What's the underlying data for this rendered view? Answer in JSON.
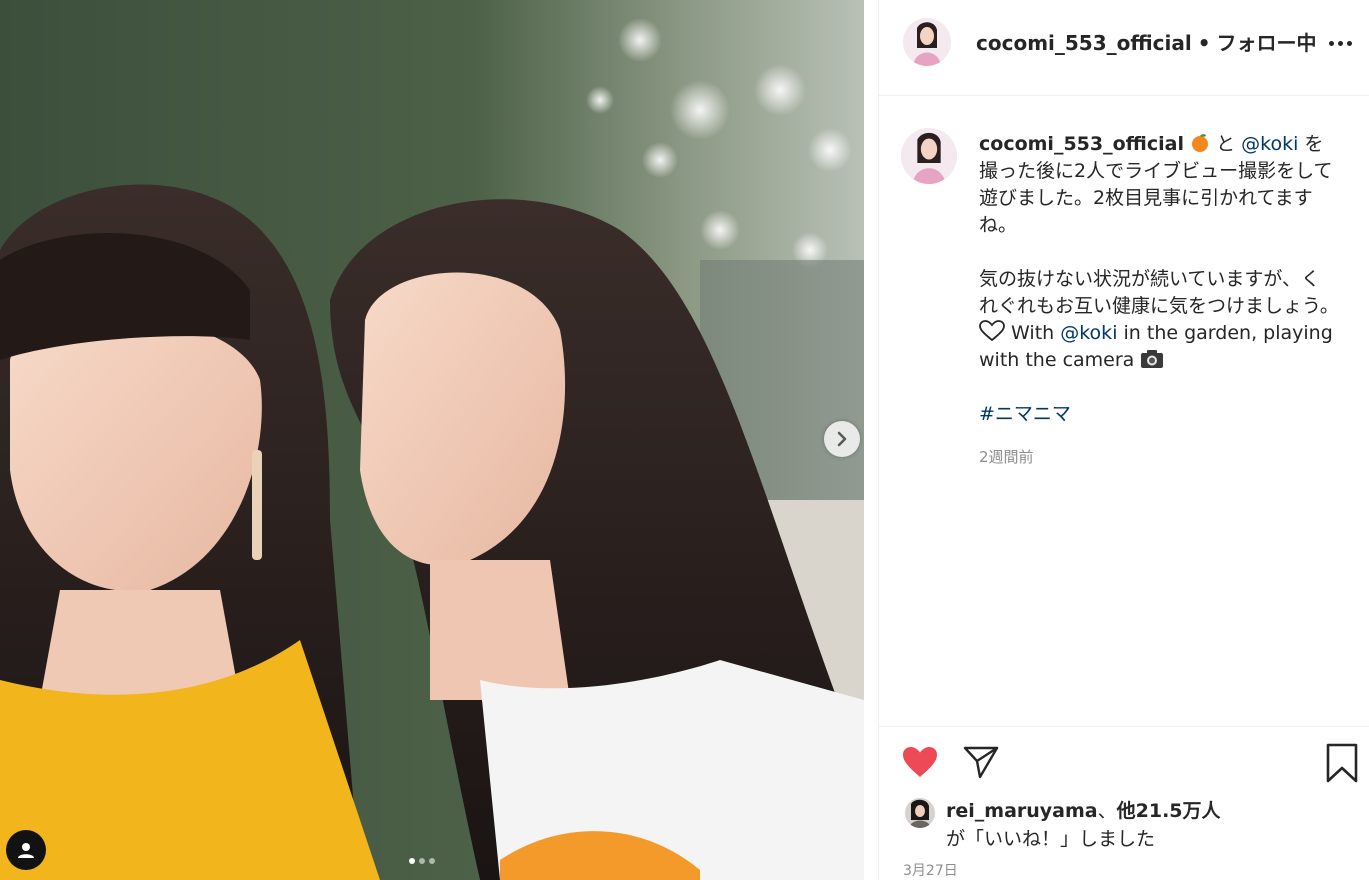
{
  "post": {
    "author": "cocomi_553_official",
    "separator": "•",
    "follow_state": "フォロー中",
    "carousel": {
      "total": 3,
      "current": 1
    }
  },
  "caption": {
    "author": "cocomi_553_official",
    "emoji_icon": "tangerine-icon",
    "part1": "と",
    "mention1": "@koki",
    "part2": "を撮った後に2人でライブビュー撮影をして遊びました。2枚目見事に引かれてますね。",
    "para2": "気の抜けない状況が続いていますが、くれぐれもお互い健康に気をつけましょう。",
    "heart_icon": "heart-outline-icon",
    "part3": "With",
    "mention2": "@koki",
    "part4": "in the garden, playing with the camera",
    "camera_icon": "camera-icon",
    "hashtag": "#ニマニマ",
    "time_ago": "2週間前"
  },
  "likes": {
    "liker": "rei_maruyama",
    "joiner": "、",
    "others": "他21.5万人",
    "suffix": "が「いいね！」しました",
    "liked": true
  },
  "date": "3月27日",
  "colors": {
    "like_red": "#ed4956",
    "link_blue": "#00376b",
    "muted_gray": "#8e8e8e",
    "text": "#262626"
  }
}
